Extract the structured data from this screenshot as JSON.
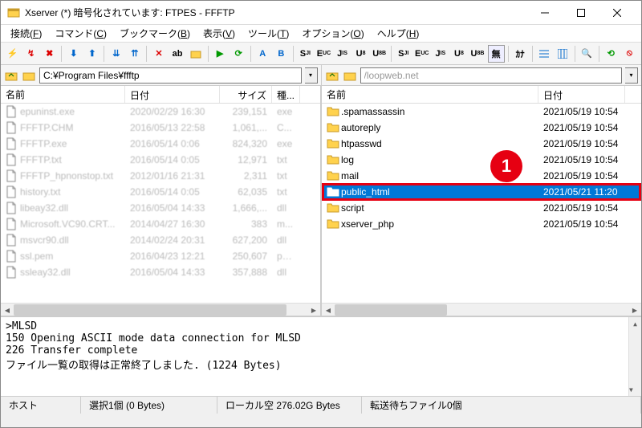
{
  "title": "Xserver (*) 暗号化されています: FTPES - FFFTP",
  "menus": [
    {
      "label": "接続",
      "key": "F"
    },
    {
      "label": "コマンド",
      "key": "C"
    },
    {
      "label": "ブックマーク",
      "key": "B"
    },
    {
      "label": "表示",
      "key": "V"
    },
    {
      "label": "ツール",
      "key": "T"
    },
    {
      "label": "オプション",
      "key": "O"
    },
    {
      "label": "ヘルプ",
      "key": "H"
    }
  ],
  "local_path": "C:¥Program Files¥ffftp",
  "remote_path": "/loopweb.net",
  "columns": {
    "name": "名前",
    "date": "日付",
    "size": "サイズ",
    "type": "種..."
  },
  "local_files": [
    {
      "name": "epuninst.exe",
      "date": "2020/02/29 16:30",
      "size": "239,151",
      "type": "exe",
      "icon": "file"
    },
    {
      "name": "FFFTP.CHM",
      "date": "2016/05/13 22:58",
      "size": "1,061,...",
      "type": "C...",
      "icon": "file"
    },
    {
      "name": "FFFTP.exe",
      "date": "2016/05/14 0:06",
      "size": "824,320",
      "type": "exe",
      "icon": "file"
    },
    {
      "name": "FFFTP.txt",
      "date": "2016/05/14 0:05",
      "size": "12,971",
      "type": "txt",
      "icon": "file"
    },
    {
      "name": "FFFTP_hpnonstop.txt",
      "date": "2012/01/16 21:31",
      "size": "2,311",
      "type": "txt",
      "icon": "file"
    },
    {
      "name": "history.txt",
      "date": "2016/05/14 0:05",
      "size": "62,035",
      "type": "txt",
      "icon": "file"
    },
    {
      "name": "libeay32.dll",
      "date": "2016/05/04 14:33",
      "size": "1,666,...",
      "type": "dll",
      "icon": "file"
    },
    {
      "name": "Microsoft.VC90.CRT...",
      "date": "2014/04/27 16:30",
      "size": "383",
      "type": "m...",
      "icon": "file"
    },
    {
      "name": "msvcr90.dll",
      "date": "2014/02/24 20:31",
      "size": "627,200",
      "type": "dll",
      "icon": "file"
    },
    {
      "name": "ssl.pem",
      "date": "2016/04/23 12:21",
      "size": "250,607",
      "type": "pe...",
      "icon": "file"
    },
    {
      "name": "ssleay32.dll",
      "date": "2016/05/04 14:33",
      "size": "357,888",
      "type": "dll",
      "icon": "file"
    }
  ],
  "remote_files": [
    {
      "name": ".spamassassin",
      "date": "2021/05/19 10:54",
      "icon": "folder"
    },
    {
      "name": "autoreply",
      "date": "2021/05/19 10:54",
      "icon": "folder"
    },
    {
      "name": "htpasswd",
      "date": "2021/05/19 10:54",
      "icon": "folder"
    },
    {
      "name": "log",
      "date": "2021/05/19 10:54",
      "icon": "folder"
    },
    {
      "name": "mail",
      "date": "2021/05/19 10:54",
      "icon": "folder"
    },
    {
      "name": "public_html",
      "date": "2021/05/21 11:20",
      "icon": "folder",
      "selected": true
    },
    {
      "name": "script",
      "date": "2021/05/19 10:54",
      "icon": "folder"
    },
    {
      "name": "xserver_php",
      "date": "2021/05/19 10:54",
      "icon": "folder"
    }
  ],
  "callout": "1",
  "log": [
    ">MLSD",
    "150 Opening ASCII mode data connection for MLSD",
    "226 Transfer complete",
    "ファイル一覧の取得は正常終了しました. (1224 Bytes)"
  ],
  "status": {
    "host": "ホスト",
    "selection": "選択1個 (0 Bytes)",
    "local_free": "ローカル空 276.02G Bytes",
    "queue": "転送待ちファイル0個"
  }
}
